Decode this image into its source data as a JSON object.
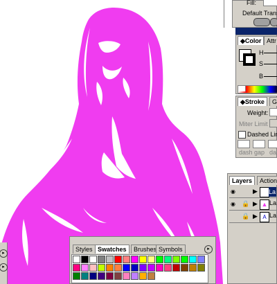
{
  "fill_panel": {
    "fill_label": "Fill:",
    "opacity_label": "Default Transp"
  },
  "color_panel": {
    "tabs": [
      "Color",
      "Attr"
    ],
    "channels": [
      "H",
      "S",
      "B"
    ],
    "fill_color": "#ffffff"
  },
  "stroke_panel": {
    "tabs": [
      "Stroke",
      "Gr"
    ],
    "weight_label": "Weight:",
    "miter_label": "Miter Limit",
    "dashed_label": "Dashed Line",
    "dash_labels": [
      "dash",
      "gap",
      "da"
    ]
  },
  "layers_panel": {
    "tabs": [
      "Layers",
      "Actions"
    ],
    "rows": [
      {
        "name": "La",
        "selected": true
      },
      {
        "name": "La",
        "selected": false
      },
      {
        "name": "La",
        "selected": false
      }
    ]
  },
  "swatches_panel": {
    "tabs": [
      "Styles",
      "Swatches",
      "Brushes",
      "Symbols"
    ],
    "active_tab": "Swatches",
    "colors": [
      "#ffffff",
      "#000000",
      "#ffffff",
      "#808080",
      "#c0c0c0",
      "#ff0000",
      "#ff8080",
      "#ff00ff",
      "#ffff00",
      "#ffff80",
      "#00ff00",
      "#00ff80",
      "#80ff00",
      "#00ff00",
      "#00ffff",
      "#8080ff",
      "#ff0080",
      "#ff80ff",
      "#ffc0c0",
      "#c0ff00",
      "#ff8000",
      "#ff8040",
      "#0000ff",
      "#0000c0",
      "#8000ff",
      "#c000ff",
      "#ff00c0",
      "#ff4080",
      "#c00000",
      "#804000",
      "#c08000",
      "#808000",
      "#008000",
      "#008080",
      "#000080",
      "#400080",
      "#800040",
      "#804040",
      "#ff80c0",
      "#c080ff",
      "#ffb000",
      "#c08040"
    ]
  },
  "colors": {
    "canvas_art": "#f03cf0",
    "panel_bg": "#d4d0c8",
    "title_bar": "#0a246a"
  }
}
